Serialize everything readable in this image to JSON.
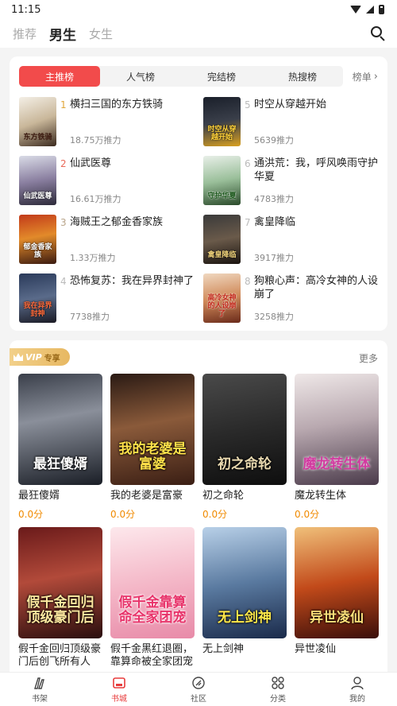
{
  "status": {
    "time": "11:15"
  },
  "topnav": {
    "tabs": [
      "推荐",
      "男生",
      "女生"
    ]
  },
  "ranking": {
    "tabs": [
      "主推榜",
      "人气榜",
      "完结榜",
      "热搜榜"
    ],
    "more_label": "榜单",
    "items": [
      {
        "rank": "1",
        "title": "横扫三国的东方铁骑",
        "popularity": "18.75万推力",
        "cover_text": "东方铁骑"
      },
      {
        "rank": "2",
        "title": "仙武医尊",
        "popularity": "16.61万推力",
        "cover_text": "仙武医尊"
      },
      {
        "rank": "3",
        "title": "海贼王之郁金香家族",
        "popularity": "1.33万推力",
        "cover_text": "郁金香家族"
      },
      {
        "rank": "4",
        "title": "恐怖复苏：我在异界封神了",
        "popularity": "7738推力",
        "cover_text": "我在异界封神"
      },
      {
        "rank": "5",
        "title": "时空从穿越开始",
        "popularity": "5639推力",
        "cover_text": "时空从穿越开始"
      },
      {
        "rank": "6",
        "title": "通洪荒：我，呼风唤雨守护华夏",
        "popularity": "4783推力",
        "cover_text": "守护华夏"
      },
      {
        "rank": "7",
        "title": "禽皇降临",
        "popularity": "3917推力",
        "cover_text": "禽皇降临"
      },
      {
        "rank": "8",
        "title": "狗粮心声：高冷女神的人设崩了",
        "popularity": "3258推力",
        "cover_text": "高冷女神的人设崩了"
      }
    ]
  },
  "vip": {
    "badge_text": "VIP",
    "badge_sub": "专享",
    "more_label": "更多",
    "books": [
      {
        "title": "最狂傻婿",
        "score": "0.0分",
        "cover_text": "最狂傻婿"
      },
      {
        "title": "我的老婆是富豪",
        "score": "0.0分",
        "cover_text": "我的老婆是富婆"
      },
      {
        "title": "初之命轮",
        "score": "0.0分",
        "cover_text": "初之命轮"
      },
      {
        "title": "魔龙转生体",
        "score": "0.0分",
        "cover_text": "魔龙转生体"
      },
      {
        "title": "假千金回归顶级豪门后创飞所有人",
        "score": "",
        "cover_text": "假千金回归顶级豪门后"
      },
      {
        "title": "假千金黑红退圈，靠算命被全家团宠",
        "score": "",
        "cover_text": "假千金靠算命全家团宠"
      },
      {
        "title": "无上剑神",
        "score": "",
        "cover_text": "无上剑神"
      },
      {
        "title": "异世凌仙",
        "score": "",
        "cover_text": "异世凌仙"
      }
    ]
  },
  "bottombar": {
    "items": [
      "书架",
      "书城",
      "社区",
      "分类",
      "我的"
    ],
    "active": "书城"
  },
  "colors": {
    "accent": "#f24b4b",
    "vip_gold": "#e7b862",
    "score": "#f08a00"
  }
}
